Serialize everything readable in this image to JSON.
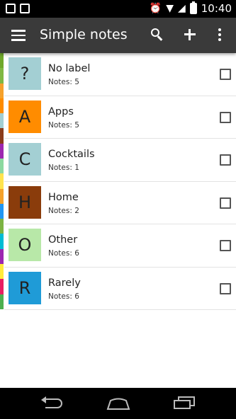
{
  "status_bar": {
    "time": "10:40"
  },
  "app_bar": {
    "title": "Simple notes",
    "icons": [
      "menu-icon",
      "search-icon",
      "add-icon",
      "more-icon"
    ]
  },
  "color_strip": [
    "#6fa82b",
    "#7fb843",
    "#f5a12b",
    "#ff8c00",
    "#a3cfd3",
    "#8a3c1c",
    "#9c27b0",
    "#8cd9a0",
    "#ffe34d",
    "#f5a12b",
    "#2196f3",
    "#7cb342",
    "#00bcd4",
    "#9c27b0",
    "#ffeb3b",
    "#e91e63",
    "#4caf50"
  ],
  "labels": [
    {
      "letter": "?",
      "title": "No label",
      "count": "Notes: 5",
      "color": "#a3cfd3"
    },
    {
      "letter": "A",
      "title": "Apps",
      "count": "Notes: 5",
      "color": "#ff8c00"
    },
    {
      "letter": "C",
      "title": "Cocktails",
      "count": "Notes: 1",
      "color": "#a3cfd3"
    },
    {
      "letter": "H",
      "title": "Home",
      "count": "Notes: 2",
      "color": "#8a3c0b"
    },
    {
      "letter": "O",
      "title": "Other",
      "count": "Notes: 6",
      "color": "#b8e8a8"
    },
    {
      "letter": "R",
      "title": "Rarely",
      "count": "Notes: 6",
      "color": "#1f9bd7"
    }
  ]
}
